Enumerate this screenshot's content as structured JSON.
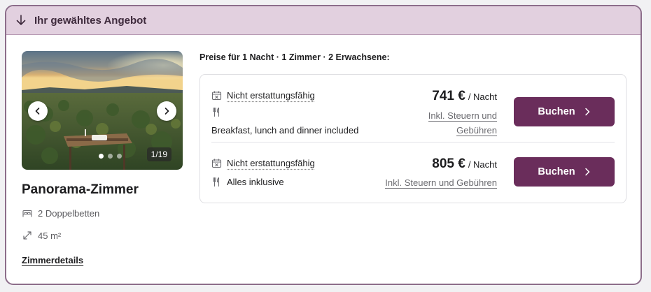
{
  "header": {
    "title": "Ihr gewähltes Angebot",
    "icon": "arrow-down-icon"
  },
  "room": {
    "name": "Panorama-Zimmer",
    "beds": "2 Doppelbetten",
    "size": "45 m²",
    "details_link": "Zimmerdetails",
    "gallery": {
      "counter": "1/19",
      "dots": 3,
      "active_dot": 0
    }
  },
  "pricing": {
    "info": "Preise für 1 Nacht · 1 Zimmer · 2 Erwachsene:",
    "offers": [
      {
        "policy": "Nicht erstattungsfähig",
        "meal": "Breakfast, lunch and dinner included",
        "price": "741 €",
        "per": "/ Nacht",
        "taxes_line1": "Inkl. Steuern und",
        "taxes_line2": "Gebühren",
        "button": "Buchen"
      },
      {
        "policy": "Nicht erstattungsfähig",
        "meal": "Alles inklusive",
        "price": "805 €",
        "per": "/ Nacht",
        "taxes": "Inkl. Steuern und Gebühren",
        "button": "Buchen"
      }
    ]
  },
  "colors": {
    "header_bg": "#e2d0df",
    "border": "#8c6d8a",
    "button_bg": "#6a2d5b"
  }
}
